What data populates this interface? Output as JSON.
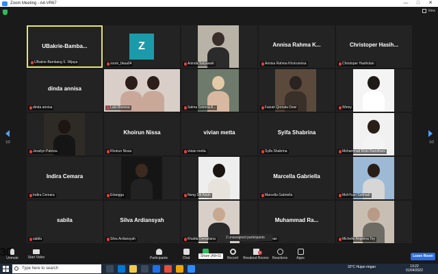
{
  "window": {
    "title": "Zoom Meeting - A4-VR67",
    "controls": [
      "—",
      "□",
      "✕"
    ]
  },
  "view_label": "View",
  "pager": {
    "left": "1/2",
    "right": "1/2"
  },
  "tiles": [
    {
      "big": "UBakrie-Bamba...",
      "label": "UBakrie-Bambang S. Wijaya",
      "active": true
    },
    {
      "avatar": "Z",
      "label": "zoom_bkaa04"
    },
    {
      "label": "Aninda Satyawati",
      "photo": "p1"
    },
    {
      "big": "Annisa  Rahma  K...",
      "label": "Annisa Rahma Khoirunnisa"
    },
    {
      "big": "Christoper  Hasih...",
      "label": "Christoper Hasiholan"
    },
    {
      "big": "dinda annisa",
      "label": "dinda annisa"
    },
    {
      "label": "Lulu Rissesa",
      "photo": "p2"
    },
    {
      "label": "Salma Sebrina A...",
      "photo": "p3"
    },
    {
      "label": "Faizah Qomala Dewi",
      "photo": "p4"
    },
    {
      "label": "Winny",
      "photo": "p5"
    },
    {
      "label": "Jessilyn Patricia",
      "photo": "p6"
    },
    {
      "big": "Khoirun Nissa",
      "label": "Khoirun Nissa"
    },
    {
      "big": "vivian metta",
      "label": "vivian metta"
    },
    {
      "big": "Syifa Shabrina",
      "label": "Syifa Shabrina"
    },
    {
      "label": "Mohammad Rizki Ramdhani",
      "photo": "p7"
    },
    {
      "big": "Indira Cemara",
      "label": "Indira Cemara"
    },
    {
      "label": "Erlangga",
      "photo": "p8"
    },
    {
      "label": "Neng Siti Aisah",
      "photo": "p9"
    },
    {
      "big": "Marcella Gabriella",
      "label": "Marcella Gabriella"
    },
    {
      "label": "MohYusri Saftriadi",
      "photo": "p10"
    },
    {
      "big": "sabila",
      "label": "sabila"
    },
    {
      "big": "Silva Ardiansyah",
      "label": "Silva Ardiansyah"
    },
    {
      "label": "Khalda Demaliana",
      "photo": "p11"
    },
    {
      "big": "Muhammad  Ra...",
      "label": "...adhan"
    },
    {
      "label": "Michelle Angelina Tey",
      "photo": "p12"
    }
  ],
  "unassigned": "2 unassigned participants",
  "toolbar": {
    "unmute": "Unmute",
    "start_video": "Start Video",
    "participants": "Participants",
    "participants_count": "30",
    "chat": "Chat",
    "share": "Share Screen",
    "share_tip": "Share (Alt+S)",
    "record": "Record",
    "breakout": "Breakout Rooms",
    "breakout_badge": "2",
    "reactions": "Reactions",
    "apps": "Apps",
    "leave": "Leave Room"
  },
  "taskbar": {
    "search_placeholder": "Type here to search",
    "weather": "32°C  Hujan ringan",
    "time": "13:22",
    "date": "01/04/2022"
  },
  "colors": {
    "accent": "#2d6ce0",
    "active_border": "#e7e76b",
    "avatar_bg": "#1b9aaa",
    "muted_mic": "#e03e3e"
  }
}
